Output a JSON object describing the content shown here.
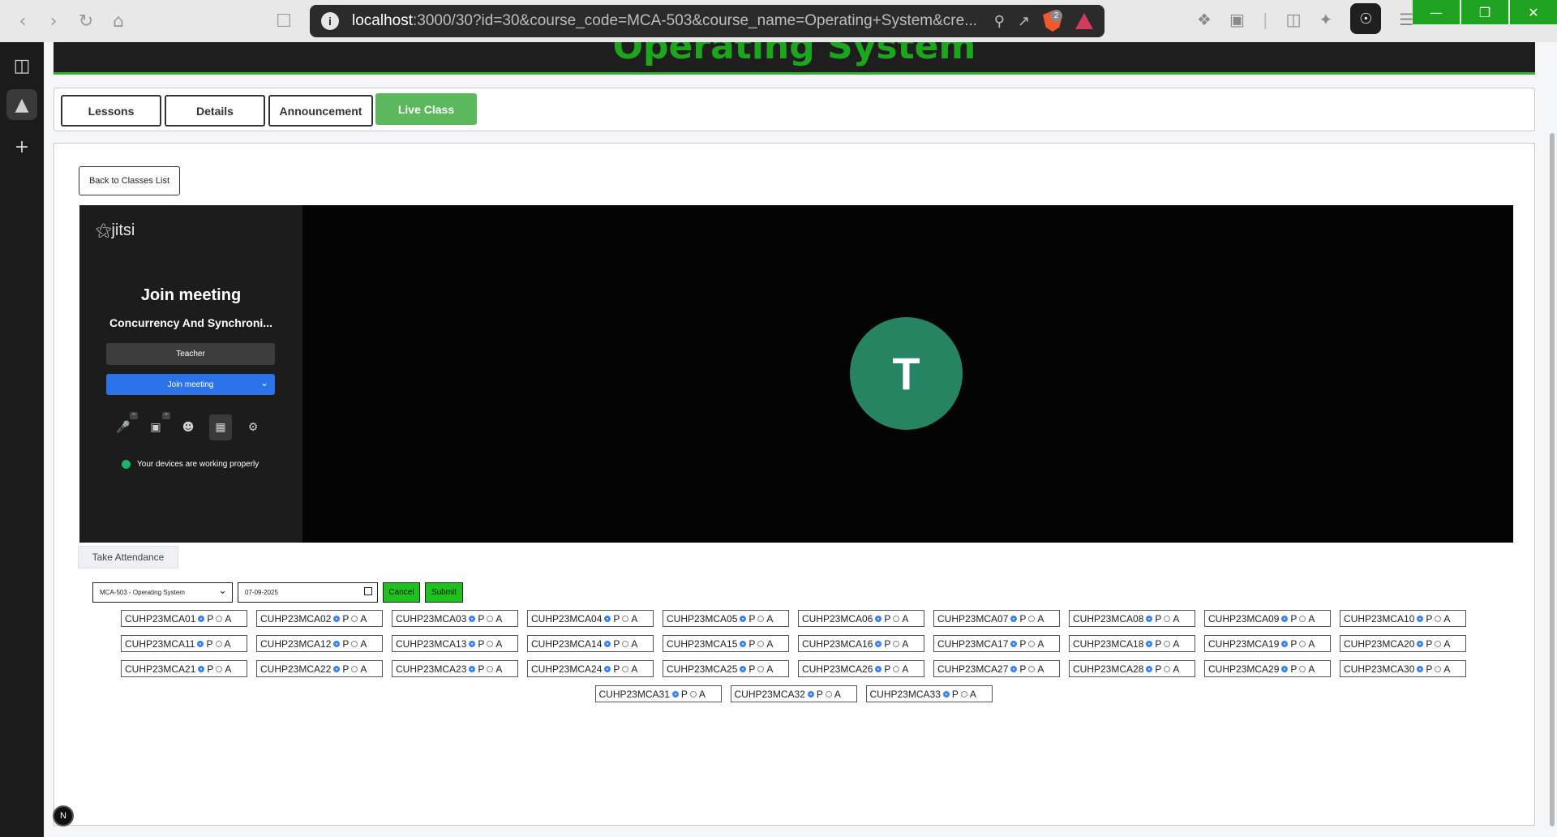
{
  "browser": {
    "url_host": "localhost",
    "url_path": ":3000/30?id=30&course_code=MCA-503&course_name=Operating+System&cre...",
    "brave_badge": "2",
    "colors": {
      "win_controls": "#1fa21f",
      "brave": "#f1592a"
    }
  },
  "header": {
    "title": "Operating System",
    "title_color": "#1ea51e"
  },
  "tabs": [
    {
      "label": "Lessons"
    },
    {
      "label": "Details"
    },
    {
      "label": "Announcement"
    },
    {
      "label": "Live Class",
      "active": true
    }
  ],
  "back_button": "Back to Classes List",
  "jitsi": {
    "logo": "jitsi",
    "join_title": "Join meeting",
    "meeting_name": "Concurrency And Synchroni...",
    "name_field": "Teacher",
    "join_button": "Join meeting",
    "device_status": "Your devices are working properly",
    "avatar_letter": "T",
    "avatar_color": "#278463"
  },
  "attendance": {
    "take_button": "Take Attendance",
    "course_select": "MCA-503 - Operating System",
    "date": "07-09-2025",
    "cancel": "Cancel",
    "submit": "Submit",
    "present_label": "P",
    "absent_label": "A",
    "students": [
      "CUHP23MCA01",
      "CUHP23MCA02",
      "CUHP23MCA03",
      "CUHP23MCA04",
      "CUHP23MCA05",
      "CUHP23MCA06",
      "CUHP23MCA07",
      "CUHP23MCA08",
      "CUHP23MCA09",
      "CUHP23MCA10",
      "CUHP23MCA11",
      "CUHP23MCA12",
      "CUHP23MCA13",
      "CUHP23MCA14",
      "CUHP23MCA15",
      "CUHP23MCA16",
      "CUHP23MCA17",
      "CUHP23MCA18",
      "CUHP23MCA19",
      "CUHP23MCA20",
      "CUHP23MCA21",
      "CUHP23MCA22",
      "CUHP23MCA23",
      "CUHP23MCA24",
      "CUHP23MCA25",
      "CUHP23MCA26",
      "CUHP23MCA27",
      "CUHP23MCA28",
      "CUHP23MCA29",
      "CUHP23MCA30",
      "CUHP23MCA31",
      "CUHP23MCA32",
      "CUHP23MCA33"
    ]
  },
  "badge": "N"
}
